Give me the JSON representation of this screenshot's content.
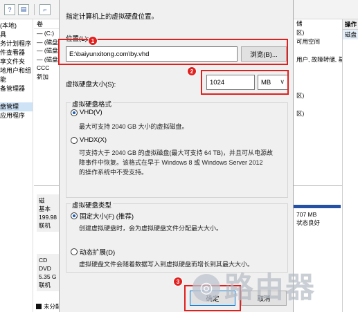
{
  "background": {
    "toolbar_icons": [
      "help-icon",
      "properties-icon",
      "disk-icon"
    ],
    "tree_items": [
      "(本地)",
      "具",
      "务计划程序",
      "件查看器",
      "享文件夹",
      "地用户和组",
      "能",
      "备管理器",
      "",
      "盘管理",
      "应用程序"
    ],
    "selected_tree_index": 9,
    "list_header": "卷",
    "list_rows": [
      "— (C:)",
      "— (磁盘",
      "— (磁盘",
      "— (磁盘",
      "CCC",
      "新加"
    ],
    "right_lines": [
      "储",
      "区)",
      "可用空间",
      "",
      "用户, 故障转储, 基",
      "",
      "",
      "",
      "区)",
      "",
      "区)"
    ],
    "ops_title": "操作",
    "ops_item": "磁盘",
    "disk1": {
      "name": "磁",
      "type": "基本",
      "size": "199.98",
      "status": "联机"
    },
    "disk2": {
      "name": "CD",
      "type": "DVD",
      "size": "5.35 G",
      "status": "联机"
    },
    "disk_right": {
      "size": "707 MB",
      "status": "状态良好"
    },
    "legend_label": "未分配"
  },
  "dialog": {
    "instruction": "指定计算机上的虚拟硬盘位置。",
    "location_label": "位置(L):",
    "location_value": "E:\\baiyunxitong.com\\by.vhd",
    "browse_label": "浏览(B)...",
    "size_label": "虚拟硬盘大小(S):",
    "size_value": "1024",
    "unit_value": "MB",
    "format_group_title": "虚拟硬盘格式",
    "vhd_label": "VHD(V)",
    "vhd_desc": "最大可支持 2040 GB 大小的虚拟磁盘。",
    "vhdx_label": "VHDX(X)",
    "vhdx_desc_1": "可支持大于 2040 GB 的虚拟磁盘(最大可支持 64 TB)，并且可从电源故",
    "vhdx_desc_2": "障事件中恢复。该格式在早于 Windows 8 或 Windows Server 2012",
    "vhdx_desc_3": "的操作系统中不受支持。",
    "type_group_title": "虚拟硬盘类型",
    "fixed_label": "固定大小(F) (推荐)",
    "fixed_desc": "创建虚拟硬盘时，会为虚拟硬盘文件分配最大大小。",
    "dynamic_label": "动态扩展(D)",
    "dynamic_desc": "虚拟硬盘文件会随着数据写入到虚拟硬盘而增长到其最大大小。",
    "ok_label": "确定",
    "cancel_label": "取消"
  },
  "annotations": {
    "badge_1": "1",
    "badge_2": "2",
    "badge_3": "3",
    "color": "#e0201e"
  },
  "watermark": {
    "text": "路由器"
  }
}
